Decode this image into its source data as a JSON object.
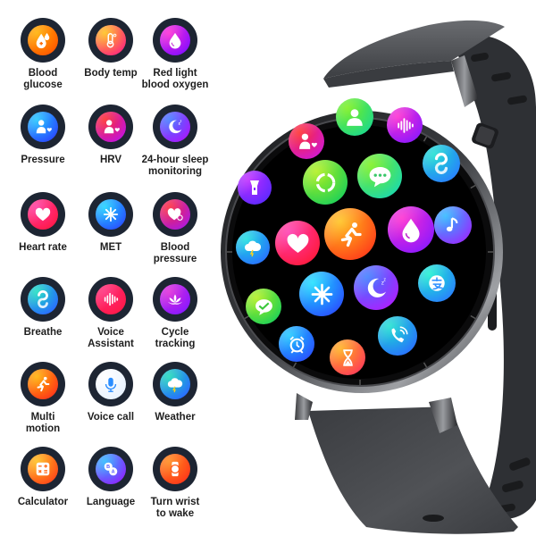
{
  "features": [
    {
      "id": "blood-glucose",
      "label": "Blood\nglucose",
      "lines": [
        "Blood",
        "glucose"
      ],
      "icon": "blood-drop-plus-icon",
      "colors": [
        "#ffb000",
        "#ff5a00"
      ]
    },
    {
      "id": "body-temp",
      "label": "Body temp",
      "lines": [
        "Body temp"
      ],
      "icon": "thermometer-icon",
      "colors": [
        "#ffc21a",
        "#ff2f7a"
      ]
    },
    {
      "id": "red-light-blood-oxygen",
      "label": "Red light blood oxygen",
      "lines": [
        "Red light",
        "blood oxygen"
      ],
      "icon": "water-drop-icon",
      "colors": [
        "#ff2ad4",
        "#8a10ff"
      ]
    },
    {
      "id": "pressure",
      "label": "Pressure",
      "lines": [
        "Pressure"
      ],
      "icon": "person-heart-icon",
      "colors": [
        "#20c8ff",
        "#2a4dff"
      ]
    },
    {
      "id": "hrv",
      "label": "HRV",
      "lines": [
        "HRV"
      ],
      "icon": "person-heart-icon",
      "colors": [
        "#ff2a2a",
        "#c415d8"
      ]
    },
    {
      "id": "sleep-monitoring",
      "label": "24-hour sleep monitoring",
      "lines": [
        "24-hour sleep",
        "monitoring"
      ],
      "icon": "moon-icon",
      "colors": [
        "#3f7bff",
        "#a31dff"
      ]
    },
    {
      "id": "heart-rate",
      "label": "Heart rate",
      "lines": [
        "Heart rate"
      ],
      "icon": "heart-icon",
      "colors": [
        "#ff3aa0",
        "#ff1a4a"
      ]
    },
    {
      "id": "met",
      "label": "MET",
      "lines": [
        "MET"
      ],
      "icon": "asterisk-icon",
      "colors": [
        "#1ad3ff",
        "#2a55ff"
      ]
    },
    {
      "id": "blood-pressure",
      "label": "Blood pressure",
      "lines": [
        "Blood",
        "pressure"
      ],
      "icon": "heart-gauge-icon",
      "colors": [
        "#ff2a3a",
        "#b01ad8"
      ]
    },
    {
      "id": "breathe",
      "label": "Breathe",
      "lines": [
        "Breathe"
      ],
      "icon": "breathe-icon",
      "colors": [
        "#1ae0c0",
        "#2a6dff"
      ]
    },
    {
      "id": "voice-assistant",
      "label": "Voice Assistant",
      "lines": [
        "Voice",
        "Assistant"
      ],
      "icon": "sound-wave-icon",
      "colors": [
        "#ff2a7a",
        "#ff1a4a"
      ]
    },
    {
      "id": "cycle-tracking",
      "label": "Cycle tracking",
      "lines": [
        "Cycle",
        "tracking"
      ],
      "icon": "lotus-icon",
      "colors": [
        "#e02ad8",
        "#8a1aff"
      ]
    },
    {
      "id": "multi-motion",
      "label": "Multi motion",
      "lines": [
        "Multi",
        "motion"
      ],
      "icon": "running-icon",
      "colors": [
        "#ffb000",
        "#ff3a1a"
      ]
    },
    {
      "id": "voice-call",
      "label": "Voice call",
      "lines": [
        "Voice call"
      ],
      "icon": "microphone-icon",
      "colors": [
        "#ffffff",
        "#e8f2ff"
      ]
    },
    {
      "id": "weather",
      "label": "Weather",
      "lines": [
        "Weather"
      ],
      "icon": "cloud-lightning-icon",
      "colors": [
        "#1adab8",
        "#2a6dff"
      ]
    },
    {
      "id": "calculator",
      "label": "Calculator",
      "lines": [
        "Calculator"
      ],
      "icon": "calculator-icon",
      "colors": [
        "#ffc01a",
        "#ff4a1a"
      ]
    },
    {
      "id": "language",
      "label": "Language",
      "lines": [
        "Language"
      ],
      "icon": "translate-icon",
      "colors": [
        "#2ab8ff",
        "#8a2aff"
      ]
    },
    {
      "id": "turn-wrist-to-wake",
      "label": "Turn wrist to wake",
      "lines": [
        "Turn wrist",
        "to wake"
      ],
      "icon": "watch-icon",
      "colors": [
        "#ff8a1a",
        "#ff3a1a"
      ]
    }
  ],
  "watch": {
    "strap_color": "#4a4c50",
    "case_color": "#2a2b2e",
    "screen_apps": [
      {
        "name": "contacts-app",
        "icon": "person-icon",
        "colors": [
          "#7af01a",
          "#1ad890"
        ]
      },
      {
        "name": "voice-assistant-app",
        "icon": "sound-wave-icon",
        "colors": [
          "#ff2ad0",
          "#8a1aff"
        ]
      },
      {
        "name": "hrv-app",
        "icon": "person-heart-icon",
        "colors": [
          "#ff2a2a",
          "#d01ad8"
        ]
      },
      {
        "name": "breathe-app",
        "icon": "breathe-icon",
        "colors": [
          "#1ae0d0",
          "#2a7dff"
        ]
      },
      {
        "name": "flashlight-app",
        "icon": "flashlight-icon",
        "colors": [
          "#c02aff",
          "#5a2aff"
        ]
      },
      {
        "name": "activity-ring-app",
        "icon": "ring-icon",
        "colors": [
          "#b0f01a",
          "#1ad05a"
        ]
      },
      {
        "name": "messages-app",
        "icon": "chat-bubble-icon",
        "colors": [
          "#7af01a",
          "#1ad8b0"
        ]
      },
      {
        "name": "multi-motion-app",
        "icon": "running-icon",
        "colors": [
          "#ffc21a",
          "#ff3a1a"
        ]
      },
      {
        "name": "blood-oxygen-app",
        "icon": "water-drop-icon",
        "colors": [
          "#ff2ad0",
          "#8a1aff"
        ]
      },
      {
        "name": "music-app",
        "icon": "music-note-icon",
        "colors": [
          "#2ab8ff",
          "#9a2aff"
        ]
      },
      {
        "name": "weather-app",
        "icon": "cloud-lightning-icon",
        "colors": [
          "#1ae0e0",
          "#2a6dff"
        ]
      },
      {
        "name": "heart-rate-app",
        "icon": "heart-icon",
        "colors": [
          "#ff3ab0",
          "#ff1a3a"
        ]
      },
      {
        "name": "met-app",
        "icon": "asterisk-icon",
        "colors": [
          "#1ae0ff",
          "#2a4dff"
        ]
      },
      {
        "name": "sleep-app",
        "icon": "moon-icon",
        "colors": [
          "#3a7bff",
          "#b01dff"
        ]
      },
      {
        "name": "alipay-app",
        "icon": "alipay-icon",
        "colors": [
          "#1af0d0",
          "#2a7dff"
        ]
      },
      {
        "name": "wechat-app",
        "icon": "check-bubble-icon",
        "colors": [
          "#b0f01a",
          "#1ad05a"
        ]
      },
      {
        "name": "alarm-app",
        "icon": "alarm-clock-icon",
        "colors": [
          "#1ac8ff",
          "#2a4dff"
        ]
      },
      {
        "name": "timer-app",
        "icon": "hourglass-icon",
        "colors": [
          "#ffb01a",
          "#ff3a5a"
        ]
      },
      {
        "name": "phone-app",
        "icon": "phone-icon",
        "colors": [
          "#1ae0d0",
          "#2a6dff"
        ]
      }
    ]
  }
}
